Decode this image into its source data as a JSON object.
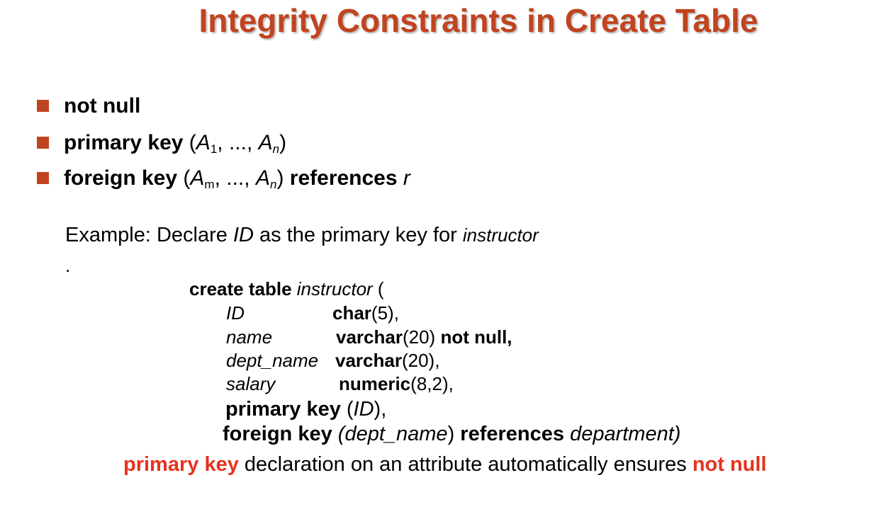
{
  "title": "Integrity Constraints in Create Table",
  "bullets": [
    {
      "text": "not null"
    },
    {
      "kw": "primary key",
      "open": "(",
      "a1": "A",
      "a1_sub": "1",
      "sep": ", ..., ",
      "an": "A",
      "an_sub": "n",
      "close": ")"
    },
    {
      "kw": "foreign key",
      "open": "(",
      "a1": "A",
      "a1_sub": "m",
      "sep": ", ..., ",
      "an": "A",
      "an_sub": "n",
      "close": ")",
      "kw2": "references",
      "rel": "r"
    }
  ],
  "example": {
    "prefix": "Example:  Declare ",
    "attr": "ID",
    "middle": " as the primary key for ",
    "table": "instructor",
    "dot": "."
  },
  "code": {
    "line1": {
      "kw": "create table",
      "name": "instructor",
      "paren": " ("
    },
    "columns": [
      {
        "name": "ID",
        "type": "char",
        "args": "(5),",
        "extra": ""
      },
      {
        "name": "name",
        "type": "varchar",
        "args": "(20) ",
        "extra": "not null,"
      },
      {
        "name": "dept_name",
        "type": "varchar",
        "args": "(20),",
        "extra": ""
      },
      {
        "name": "salary",
        "type": "numeric",
        "args": "(8,2),",
        "extra": ""
      }
    ],
    "pk": {
      "kw": "primary key",
      "open": " (",
      "attr": "ID",
      "close": "),"
    },
    "fk": {
      "kw": "foreign key",
      "attr": "(dept_name",
      "close": ") ",
      "kw2": "references",
      "ref": "department)"
    }
  },
  "note": {
    "kw": "primary key",
    "text": " declaration on an attribute automatically ensures ",
    "kw2": "not null"
  },
  "colors": {
    "title": "#c0441f",
    "bullet": "#c0441f",
    "highlight": "#e8321e"
  }
}
